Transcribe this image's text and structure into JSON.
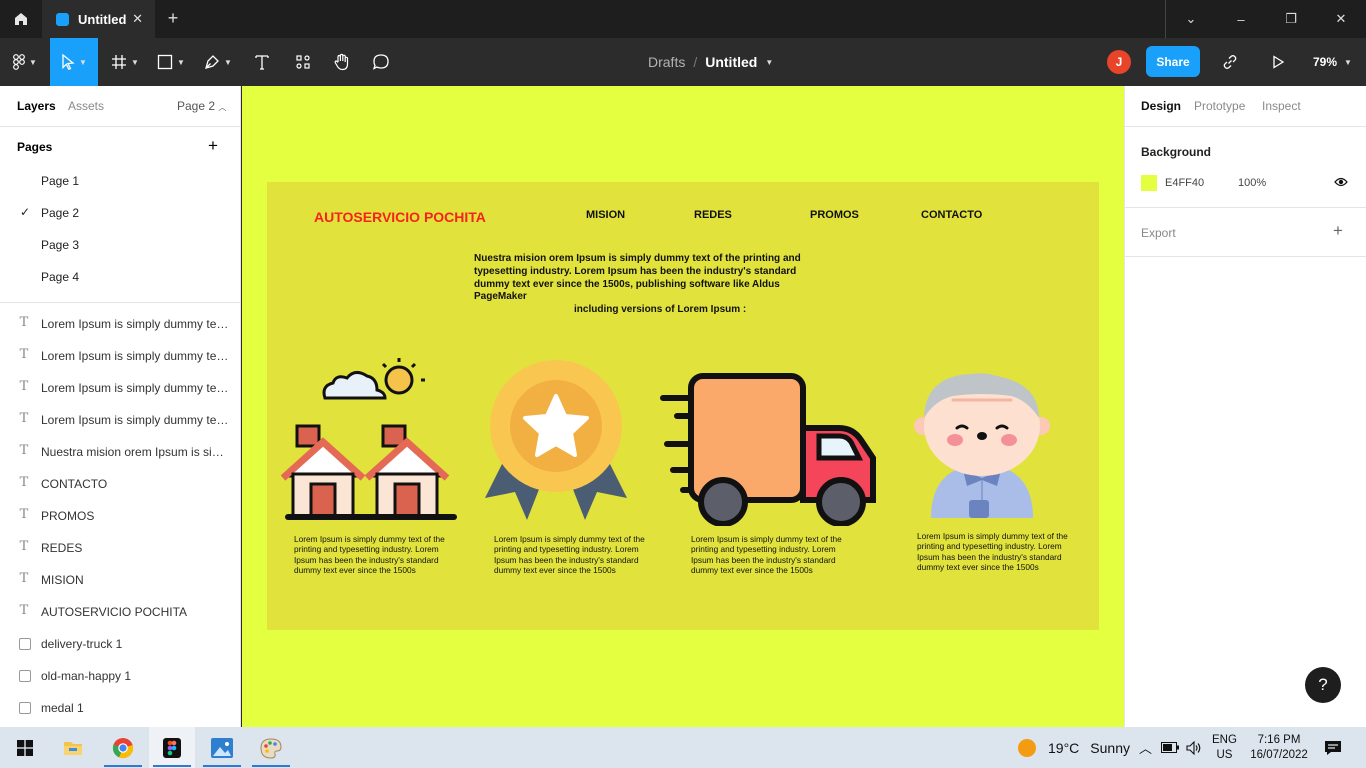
{
  "window": {
    "tab_title": "Untitled",
    "new_tab": "+",
    "tab_close": "✕",
    "controls": [
      "⌄",
      "–",
      "❐",
      "✕"
    ]
  },
  "toolbar": {
    "breadcrumb_parent": "Drafts",
    "breadcrumb_sep": "/",
    "file_name": "Untitled",
    "avatar_initial": "J",
    "share_label": "Share",
    "zoom": "79%"
  },
  "left_panel": {
    "tab_layers": "Layers",
    "tab_assets": "Assets",
    "current_page": "Page 2",
    "pages_title": "Pages",
    "pages": [
      "Page 1",
      "Page 2",
      "Page 3",
      "Page 4"
    ],
    "selected_page": "Page 2",
    "layers": [
      {
        "type": "text",
        "name": "Lorem Ipsum is simply dummy tex..."
      },
      {
        "type": "text",
        "name": "Lorem Ipsum is simply dummy tex..."
      },
      {
        "type": "text",
        "name": "Lorem Ipsum is simply dummy tex..."
      },
      {
        "type": "text",
        "name": "Lorem Ipsum is simply dummy tex..."
      },
      {
        "type": "text",
        "name": "Nuestra mision orem Ipsum is sim..."
      },
      {
        "type": "text",
        "name": "CONTACTO"
      },
      {
        "type": "text",
        "name": "PROMOS"
      },
      {
        "type": "text",
        "name": "REDES"
      },
      {
        "type": "text",
        "name": "MISION"
      },
      {
        "type": "text",
        "name": "AUTOSERVICIO POCHITA"
      },
      {
        "type": "image",
        "name": "delivery-truck 1"
      },
      {
        "type": "image",
        "name": "old-man-happy 1"
      },
      {
        "type": "image",
        "name": "medal 1"
      }
    ]
  },
  "canvas": {
    "background": "#e4ff40",
    "frame_color": "#e1e33c",
    "brand": "AUTOSERVICIO POCHITA",
    "nav": [
      "MISION",
      "REDES",
      "PROMOS",
      "CONTACTO"
    ],
    "mission_text": "Nuestra mision orem Ipsum is simply dummy text of the printing and typesetting industry. Lorem Ipsum has been the industry's standard dummy text ever since the 1500s,  publishing software like Aldus PageMaker",
    "mission_text_2": "including versions of Lorem Ipsum :",
    "cards": [
      {
        "icon": "houses-illustration",
        "text": "Lorem Ipsum is simply dummy text of the printing and typesetting industry. Lorem Ipsum has been the industry's standard dummy text ever since the 1500s"
      },
      {
        "icon": "medal-illustration",
        "text": "Lorem Ipsum is simply dummy text of the printing and typesetting industry. Lorem Ipsum has been the industry's standard dummy text ever since the 1500s"
      },
      {
        "icon": "delivery-truck-illustration",
        "text": "Lorem Ipsum is simply dummy text of the printing and typesetting industry. Lorem Ipsum has been the industry's standard dummy text ever since the 1500s"
      },
      {
        "icon": "old-man-happy-illustration",
        "text": "Lorem Ipsum is simply dummy text of the printing and typesetting industry. Lorem Ipsum has been the industry's standard dummy text ever since the 1500s"
      }
    ]
  },
  "right_panel": {
    "tabs": [
      "Design",
      "Prototype",
      "Inspect"
    ],
    "active_tab": "Design",
    "background_title": "Background",
    "bg_hex": "E4FF40",
    "bg_opacity": "100%",
    "export_label": "Export",
    "help": "?"
  },
  "taskbar": {
    "weather_temp": "19°C",
    "weather_cond": "Sunny",
    "lang_line1": "ENG",
    "lang_line2": "US",
    "time": "7:16 PM",
    "date": "16/07/2022",
    "accent": "#2a7ad6"
  }
}
